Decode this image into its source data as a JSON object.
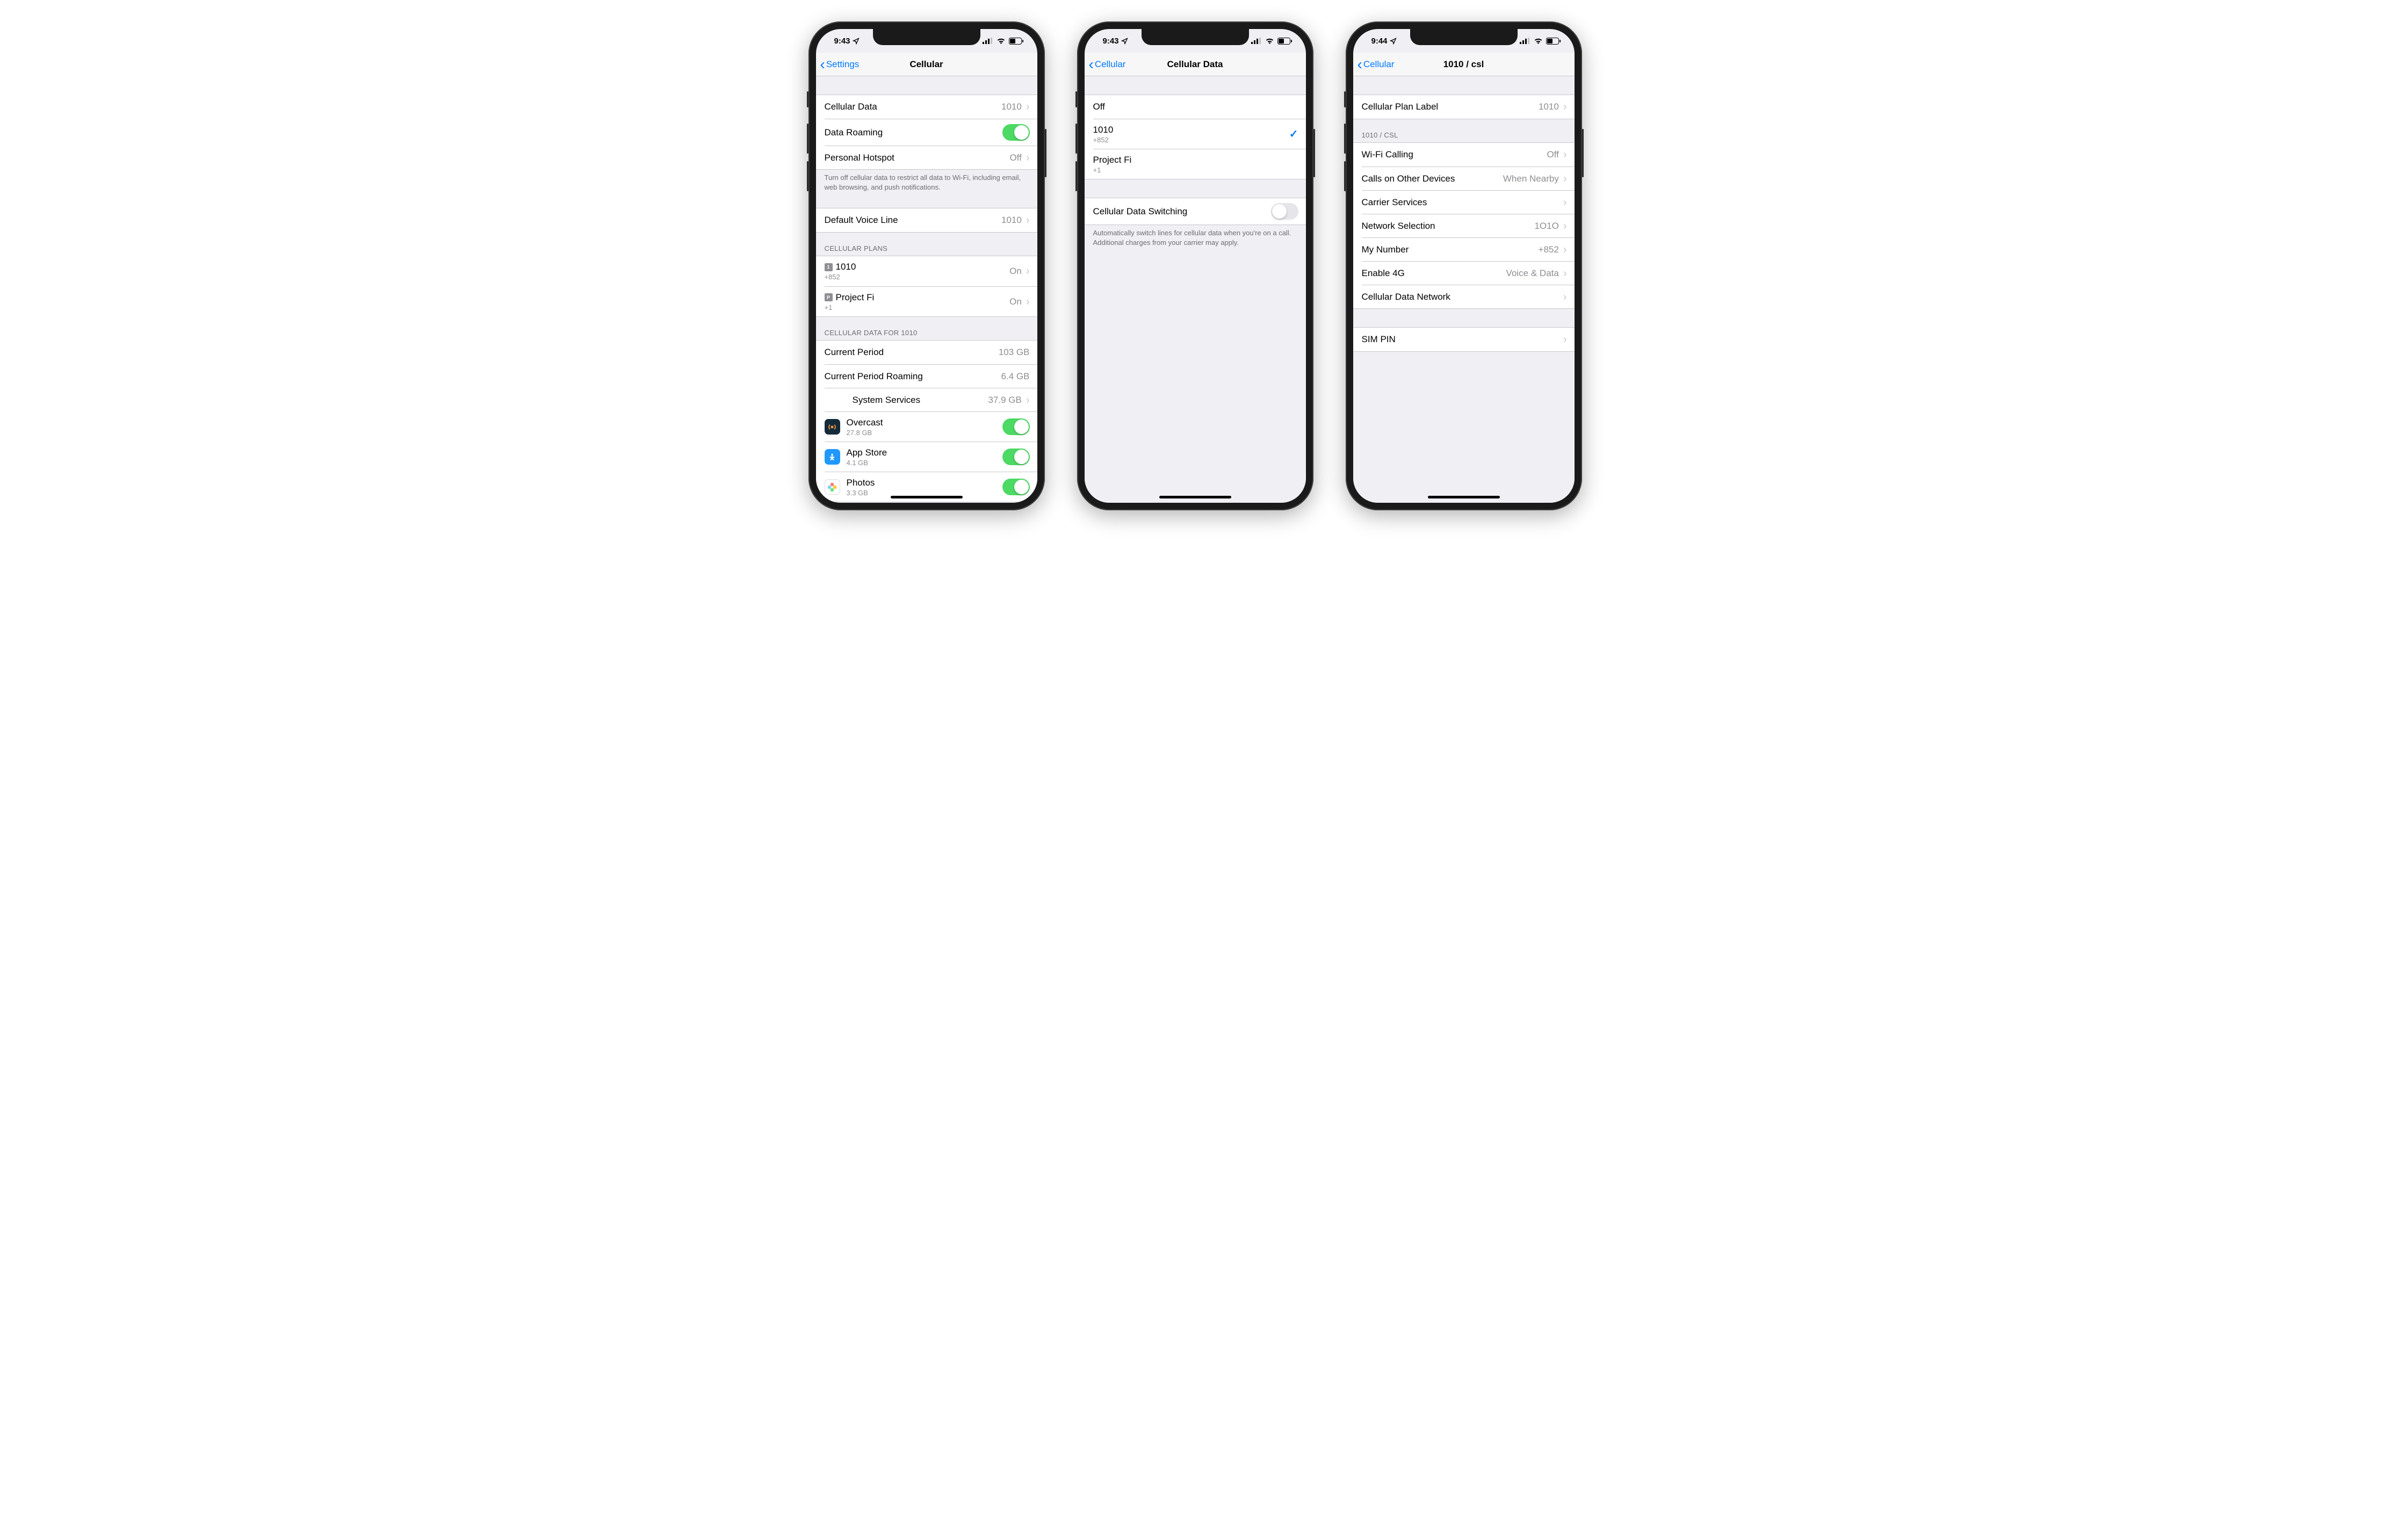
{
  "status": {
    "time_a": "9:43",
    "time_c": "9:44"
  },
  "screen1": {
    "back": "Settings",
    "title": "Cellular",
    "rows": {
      "cellular_data": {
        "label": "Cellular Data",
        "value": "1010"
      },
      "data_roaming": {
        "label": "Data Roaming",
        "on": true
      },
      "personal_hotspot": {
        "label": "Personal Hotspot",
        "value": "Off"
      }
    },
    "footer1": "Turn off cellular data to restrict all data to Wi-Fi, including email, web browsing, and push notifications.",
    "default_voice": {
      "label": "Default Voice Line",
      "value": "1010"
    },
    "plans_header": "CELLULAR PLANS",
    "plans": [
      {
        "badge": "1",
        "name": "1010",
        "number": "+852",
        "status": "On"
      },
      {
        "badge": "P",
        "name": "Project Fi",
        "number": "+1",
        "status": "On"
      }
    ],
    "usage_header": "CELLULAR DATA FOR 1010",
    "usage": {
      "current_period": {
        "label": "Current Period",
        "value": "103 GB"
      },
      "current_roaming": {
        "label": "Current Period Roaming",
        "value": "6.4 GB"
      },
      "system_services": {
        "label": "System Services",
        "value": "37.9 GB"
      }
    },
    "apps": [
      {
        "name": "Overcast",
        "size": "27.8 GB",
        "color": "#0a2a3a",
        "on": true
      },
      {
        "name": "App Store",
        "size": "4.1 GB",
        "color": "#1f98ff",
        "on": true
      },
      {
        "name": "Photos",
        "size": "3.3 GB",
        "color": "#ffffff",
        "on": true
      }
    ]
  },
  "screen2": {
    "back": "Cellular",
    "title": "Cellular Data",
    "off_label": "Off",
    "options": [
      {
        "name": "1010",
        "number": "+852",
        "selected": true
      },
      {
        "name": "Project Fi",
        "number": "+1",
        "selected": false
      }
    ],
    "switching": {
      "label": "Cellular Data Switching",
      "on": false
    },
    "switching_footer": "Automatically switch lines for cellular data when you're on a call. Additional charges from your carrier may apply."
  },
  "screen3": {
    "back": "Cellular",
    "title": "1010 / csl",
    "plan_label": {
      "label": "Cellular Plan Label",
      "value": "1010"
    },
    "section_header": "1010 / CSL",
    "rows": [
      {
        "label": "Wi-Fi Calling",
        "value": "Off"
      },
      {
        "label": "Calls on Other Devices",
        "value": "When Nearby"
      },
      {
        "label": "Carrier Services",
        "value": ""
      },
      {
        "label": "Network Selection",
        "value": "1O1O"
      },
      {
        "label": "My Number",
        "value": "+852"
      },
      {
        "label": "Enable 4G",
        "value": "Voice & Data"
      },
      {
        "label": "Cellular Data Network",
        "value": ""
      }
    ],
    "sim_pin": {
      "label": "SIM PIN"
    }
  }
}
